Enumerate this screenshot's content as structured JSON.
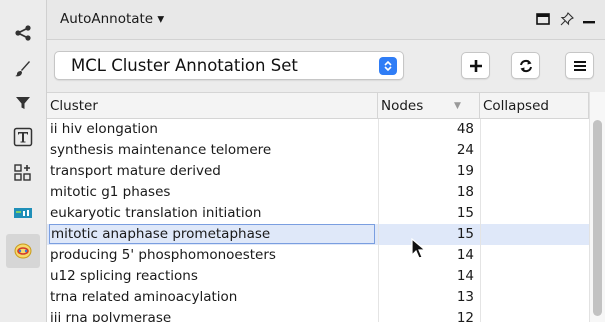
{
  "header": {
    "app_menu_label": "AutoAnnotate ▾"
  },
  "annotation_set": {
    "selected": "MCL Cluster Annotation Set"
  },
  "table": {
    "columns": [
      "Cluster",
      "Nodes",
      "Collapsed"
    ],
    "sort_indicator": "▼",
    "rows": [
      {
        "cluster": "ii hiv elongation",
        "nodes": "48",
        "collapsed": ""
      },
      {
        "cluster": "synthesis maintenance telomere",
        "nodes": "24",
        "collapsed": ""
      },
      {
        "cluster": "transport mature derived",
        "nodes": "19",
        "collapsed": ""
      },
      {
        "cluster": "mitotic g1 phases",
        "nodes": "18",
        "collapsed": ""
      },
      {
        "cluster": "eukaryotic translation initiation",
        "nodes": "15",
        "collapsed": ""
      },
      {
        "cluster": "mitotic anaphase prometaphase",
        "nodes": "15",
        "collapsed": ""
      },
      {
        "cluster": "producing 5' phosphomonoesters",
        "nodes": "14",
        "collapsed": ""
      },
      {
        "cluster": "u12 splicing reactions",
        "nodes": "14",
        "collapsed": ""
      },
      {
        "cluster": "trna related aminoacylation",
        "nodes": "13",
        "collapsed": ""
      },
      {
        "cluster": "iii rna polymerase",
        "nodes": "12",
        "collapsed": ""
      }
    ]
  },
  "sidebar": {
    "icons": [
      "share-icon",
      "brush-icon",
      "filter-icon",
      "text-icon",
      "add-nodes-icon",
      "legend-icon",
      "autoannotate-icon"
    ]
  },
  "colors": {
    "accent": "#2f7df6",
    "selected_row": "#dfe8f9"
  }
}
